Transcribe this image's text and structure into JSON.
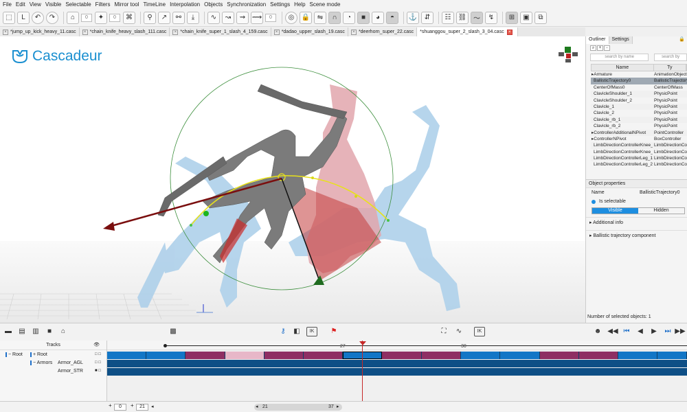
{
  "menu": [
    "File",
    "Edit",
    "View",
    "Visible",
    "Selectable",
    "Filters",
    "Mirror tool",
    "TimeLine",
    "Interpolation",
    "Objects",
    "Synchronization",
    "Settings",
    "Help",
    "Scene mode"
  ],
  "toolbar": {
    "counter_a": "0",
    "counter_b": "0",
    "counter_c": "0"
  },
  "tabs": [
    {
      "label": "*jump_up_kick_heavy_11.casc",
      "active": false
    },
    {
      "label": "*chain_knife_heavy_slash_111.casc",
      "active": false
    },
    {
      "label": "*chain_knife_super_1_slash_4_159.casc",
      "active": false
    },
    {
      "label": "*dadao_upper_slash_19.casc",
      "active": false
    },
    {
      "label": "*deerhorn_super_22.casc",
      "active": false
    },
    {
      "label": "*shuanggou_super_2_slash_3_04.casc",
      "active": true
    }
  ],
  "logo": {
    "text": "Cascadeur"
  },
  "right_panel": {
    "tabs": [
      "Outliner",
      "Settings"
    ],
    "tools": [
      "+",
      "-"
    ],
    "search_name_placeholder": "search by name",
    "search_type_placeholder": "search by",
    "columns": [
      "Name",
      "Ty"
    ],
    "rows": [
      {
        "name": "Armature",
        "type": "AnimationObject",
        "expand": true,
        "selected": false
      },
      {
        "name": "BallisticTrajectory0",
        "type": "BallisticTrajectory",
        "expand": false,
        "selected": true
      },
      {
        "name": "CenterOfMass0",
        "type": "CenterOfMass",
        "expand": false,
        "selected": false
      },
      {
        "name": "ClavicleShoulder_1",
        "type": "PhysicPoint",
        "expand": false,
        "selected": false
      },
      {
        "name": "ClavicleShoulder_2",
        "type": "PhysicPoint",
        "expand": false,
        "selected": false
      },
      {
        "name": "Clavicle_1",
        "type": "PhysicPoint",
        "expand": false,
        "selected": false
      },
      {
        "name": "Clavicle_2",
        "type": "PhysicPoint",
        "expand": false,
        "selected": false
      },
      {
        "name": "Clavicle_rb_1",
        "type": "PhysicPoint",
        "expand": false,
        "selected": false
      },
      {
        "name": "Clavicle_rb_2",
        "type": "PhysicPoint",
        "expand": false,
        "selected": false
      },
      {
        "name": "ControllerAdditionalNPivot",
        "type": "PointController",
        "expand": true,
        "selected": false
      },
      {
        "name": "ControllerNPivot",
        "type": "BoxController",
        "expand": true,
        "selected": false
      },
      {
        "name": "LimbDirectionControllerKnee_1",
        "type": "LimbDirectionCo",
        "expand": false,
        "selected": false
      },
      {
        "name": "LimbDirectionControllerKnee_2",
        "type": "LimbDirectionCo",
        "expand": false,
        "selected": false
      },
      {
        "name": "LimbDirectionControllerLeg_1",
        "type": "LimbDirectionCo",
        "expand": false,
        "selected": false
      },
      {
        "name": "LimbDirectionControllerLeg_2",
        "type": "LimbDirectionCo",
        "expand": false,
        "selected": false
      }
    ],
    "properties": {
      "title": "Object properties",
      "name_label": "Name",
      "name_value": "BallisticTrajectory0",
      "selectable_label": "Is selectable",
      "visible_label": "Visible",
      "hidden_label": "Hidden",
      "sections": [
        "Additional info",
        "Ballistic trajectory component"
      ]
    },
    "status": "Number of selected objects: 1"
  },
  "timeline": {
    "tracks_header": "Tracks",
    "tree": [
      {
        "label": "Root",
        "indent": 0
      },
      {
        "label": "Root",
        "indent": 1
      },
      {
        "label": "Armors",
        "indent": 1
      },
      {
        "label": "Armor_AGL",
        "indent": 2
      },
      {
        "label": "Armor_STR",
        "indent": 2
      }
    ],
    "ruler_labels": [
      {
        "text": "27",
        "frame": 27
      },
      {
        "text": "30",
        "frame": 30
      }
    ],
    "current_frame": 27,
    "range_start": "0",
    "range_end": "21",
    "scroll_start": "21",
    "scroll_end": "37",
    "colors": {
      "blue": "#1276c6",
      "maroon": "#8e2f63",
      "pink": "#e7b7c8",
      "dark": "#0e4f86",
      "playhead": "#c62828"
    }
  }
}
